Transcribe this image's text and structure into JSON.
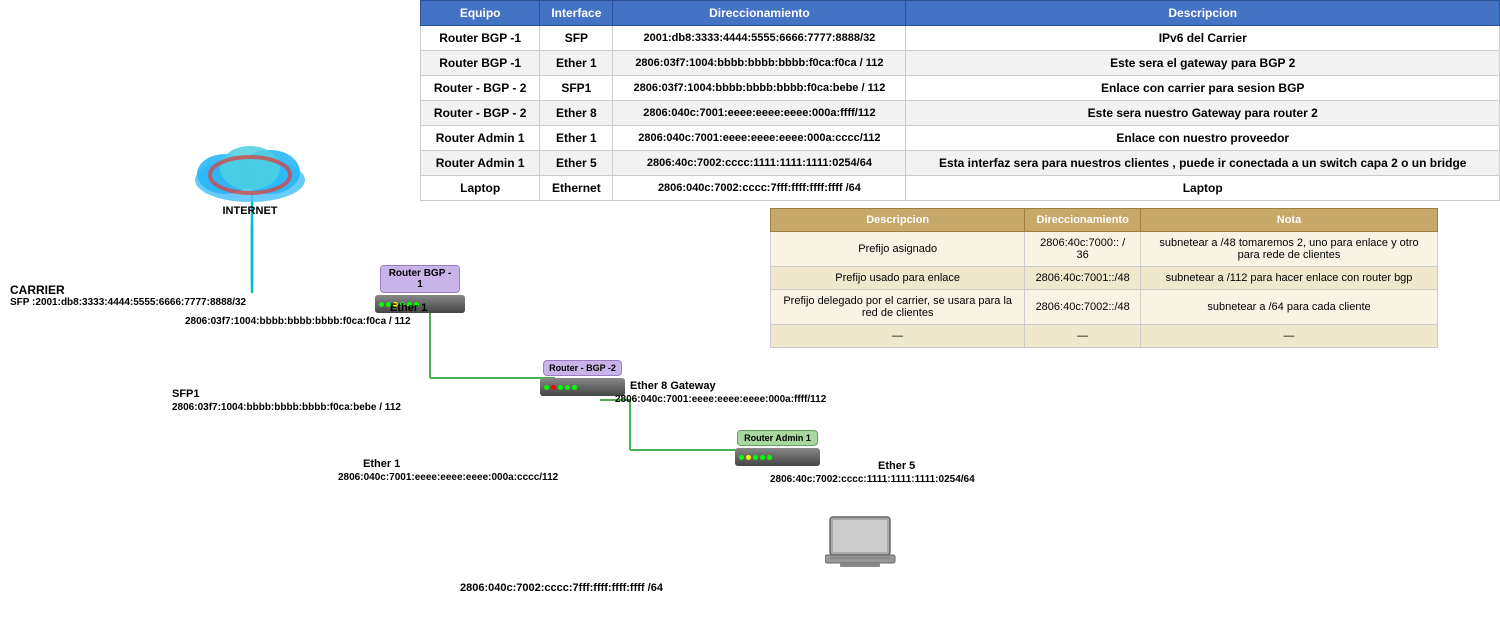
{
  "mainTable": {
    "headers": [
      "Equipo",
      "Interface",
      "Direccionamiento",
      "Descripcion"
    ],
    "rows": [
      [
        "Router BGP -1",
        "SFP",
        "2001:db8:3333:4444:5555:6666:7777:8888/32",
        "IPv6 del Carrier"
      ],
      [
        "Router BGP -1",
        "Ether 1",
        "2806:03f7:1004:bbbb:bbbb:bbbb:f0ca:f0ca / 112",
        "Este sera el gateway para BGP 2"
      ],
      [
        "Router - BGP - 2",
        "SFP1",
        "2806:03f7:1004:bbbb:bbbb:bbbb:f0ca:bebe / 112",
        "Enlace con carrier para sesion BGP"
      ],
      [
        "Router - BGP - 2",
        "Ether 8",
        "2806:040c:7001:eeee:eeee:eeee:000a:ffff/112",
        "Este sera nuestro Gateway para router 2"
      ],
      [
        "Router Admin 1",
        "Ether 1",
        "2806:040c:7001:eeee:eeee:eeee:000a:cccc/112",
        "Enlace con nuestro proveedor"
      ],
      [
        "Router Admin 1",
        "Ether 5",
        "2806:40c:7002:cccc:1111:1111:1111:0254/64",
        "Esta interfaz sera para nuestros clientes , puede ir conectada a un switch capa 2 o un bridge"
      ],
      [
        "Laptop",
        "Ethernet",
        "2806:040c:7002:cccc:7fff:ffff:ffff:ffff /64",
        "Laptop"
      ]
    ]
  },
  "secondTable": {
    "headers": [
      "Descripcion",
      "Direccionamiento",
      "Nota"
    ],
    "rows": [
      [
        "Prefijo asignado",
        "2806:40c:7000:: / 36",
        "subnetear a /48  tomaremos 2, uno para enlace y otro para rede de clientes"
      ],
      [
        "Prefijo usado para enlace",
        "2806:40c:7001::/48",
        "subnetear a /112 para hacer enlace con router bgp"
      ],
      [
        "Prefijo delegado por el carrier, se usara para la red de clientes",
        "2806:40c:7002::/48",
        "subnetear a /64 para cada cliente"
      ],
      [
        "—",
        "—",
        "—"
      ]
    ]
  },
  "diagram": {
    "internet_label": "INTERNET",
    "carrier_label": "CARRIER",
    "carrier_addr": "SFP :2001:db8:3333:4444:5555:6666:7777:8888/32",
    "router_bgp1_label": "Router BGP -\n1",
    "router_bgp2_label": "Router - BGP -2",
    "router_admin1_label": "Router Admin 1",
    "ether1_label": "Ether 1",
    "ether1_addr": "2806:03f7:1004:bbbb:bbbb:bbbb:f0ca:f0ca / 112",
    "sfp1_label": "SFP1",
    "sfp1_addr": "2806:03f7:1004:bbbb:bbbb:bbbb:f0ca:bebe / 112",
    "ether8_label": "Ether 8 Gateway",
    "ether8_addr": "2806:040c:7001:eeee:eeee:eeee:000a:ffff/112",
    "ether1b_label": "Ether 1",
    "ether1b_addr": "2806:040c:7001:eeee:eeee:eeee:000a:cccc/112",
    "ether5_label": "Ether 5",
    "ether5_addr": "2806:40c:7002:cccc:1111:1111:1111:0254/64",
    "laptop_addr": "2806:040c:7002:cccc:7fff:ffff:ffff:ffff /64",
    "laptop_label": "Laptop"
  },
  "colors": {
    "table_header": "#4472c4",
    "table2_header": "#c6a86b",
    "router_bgp1_bg": "#c8b4e8",
    "router_admin1_bg": "#a8d8a0",
    "line_carrier": "#00bcd4",
    "line_green": "#4caf50",
    "line_purple": "#9c27b0",
    "line_pink": "#e91e63"
  }
}
